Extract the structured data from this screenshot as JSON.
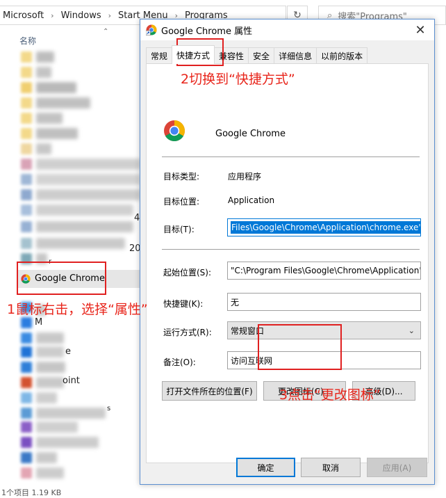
{
  "explorer": {
    "breadcrumb": [
      "Microsoft",
      "Windows",
      "Start Menu",
      "Programs"
    ],
    "search_placeholder": "搜索\"Programs\"",
    "column_name": "名称",
    "selected_item": "Google Chrome",
    "fragments": [
      "4",
      "20",
      "r",
      "M",
      "e",
      "oint",
      "s"
    ],
    "status": "1个项目 1.19 KB"
  },
  "dialog": {
    "title": "Google Chrome 属性",
    "tabs": [
      "常规",
      "快捷方式",
      "兼容性",
      "安全",
      "详细信息",
      "以前的版本"
    ],
    "active_tab_index": 1,
    "app_name": "Google Chrome",
    "target_type_label": "目标类型:",
    "target_type_value": "应用程序",
    "target_location_label": "目标位置:",
    "target_location_value": "Application",
    "target_label": "目标(T):",
    "target_value": "Files\\Google\\Chrome\\Application\\chrome.exe\"",
    "start_in_label": "起始位置(S):",
    "start_in_value": "\"C:\\Program Files\\Google\\Chrome\\Application\"",
    "shortcut_key_label": "快捷键(K):",
    "shortcut_key_value": "无",
    "run_label": "运行方式(R):",
    "run_value": "常规窗口",
    "comment_label": "备注(O):",
    "comment_value": "访问互联网",
    "open_location_button": "打开文件所在的位置(F)",
    "change_icon_button": "更改图标(C)...",
    "advanced_button": "高级(D)...",
    "ok_button": "确定",
    "cancel_button": "取消",
    "apply_button": "应用(A)"
  },
  "annotations": {
    "step1": "1鼠标右击，选择“属性”",
    "step2": "2切换到“快捷方式”",
    "step3": "3点击“更改图标”",
    "color": "#e8251b"
  },
  "colors": {
    "accent": "#0078d7",
    "annotation_red": "#e02020"
  }
}
